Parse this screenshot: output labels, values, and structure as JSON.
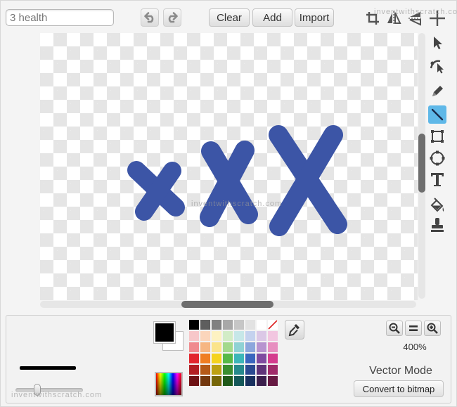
{
  "costume_name": {
    "value": "3 health"
  },
  "toolbar": {
    "undo_icon": "undo-icon",
    "redo_icon": "redo-icon",
    "clear_label": "Clear",
    "add_label": "Add",
    "import_label": "Import",
    "crop_icon": "crop-icon",
    "flip_h_icon": "flip-horizontal-icon",
    "flip_v_icon": "flip-vertical-icon",
    "center_icon": "set-center-icon"
  },
  "watermarks": {
    "top": "inventwithscratch.com",
    "center": "inventwithscratch.com",
    "bottom": "inventwithscratch.com"
  },
  "canvas": {
    "shape_color": "#3c55a6",
    "shapes": [
      "x-small",
      "x-medium",
      "x-large"
    ]
  },
  "tools": [
    {
      "name": "select-tool",
      "icon": "arrow-icon",
      "selected": false
    },
    {
      "name": "reshape-tool",
      "icon": "reshape-icon",
      "selected": false
    },
    {
      "name": "pencil-tool",
      "icon": "pencil-icon",
      "selected": false
    },
    {
      "name": "line-tool",
      "icon": "line-icon",
      "selected": true
    },
    {
      "name": "rectangle-tool",
      "icon": "rectangle-icon",
      "selected": false
    },
    {
      "name": "ellipse-tool",
      "icon": "ellipse-icon",
      "selected": false
    },
    {
      "name": "text-tool",
      "icon": "text-icon",
      "selected": false
    },
    {
      "name": "fill-tool",
      "icon": "paint-bucket-icon",
      "selected": false
    },
    {
      "name": "duplicate-tool",
      "icon": "stamp-icon",
      "selected": false
    }
  ],
  "colors": {
    "foreground": "#000000",
    "background": "#ffffff",
    "palette": [
      "#000000",
      "#5e5e5e",
      "#818181",
      "#a8a8a8",
      "#c6c6c6",
      "#e2e2e2",
      "#ffffff",
      "none",
      "#f7c7c9",
      "#fbd5bb",
      "#fdf2c2",
      "#d2ecc6",
      "#c6e7e8",
      "#c4d2ee",
      "#dbc8e6",
      "#f2c6e0",
      "#f08a8e",
      "#f6b683",
      "#fbe48a",
      "#a3d98c",
      "#8fd2d4",
      "#8ca7dc",
      "#b794cf",
      "#e78fc0",
      "#e2262d",
      "#ef7e22",
      "#f5d31c",
      "#56b948",
      "#3cb6b8",
      "#3a66be",
      "#7f4ba0",
      "#d43c8e",
      "#b21e22",
      "#b55a18",
      "#bda111",
      "#3a8f30",
      "#268a8c",
      "#2a4a91",
      "#5f3479",
      "#a02b6a",
      "#6e1214",
      "#73380e",
      "#766608",
      "#205a1a",
      "#155859",
      "#18305e",
      "#3b1f4c",
      "#671a43"
    ]
  },
  "zoom": {
    "out_icon": "zoom-out-icon",
    "reset_icon": "zoom-reset-icon",
    "in_icon": "zoom-in-icon",
    "level": "400%"
  },
  "mode": {
    "label": "Vector Mode",
    "convert_label": "Convert to bitmap"
  },
  "brush": {
    "size_fraction": 0.32
  }
}
